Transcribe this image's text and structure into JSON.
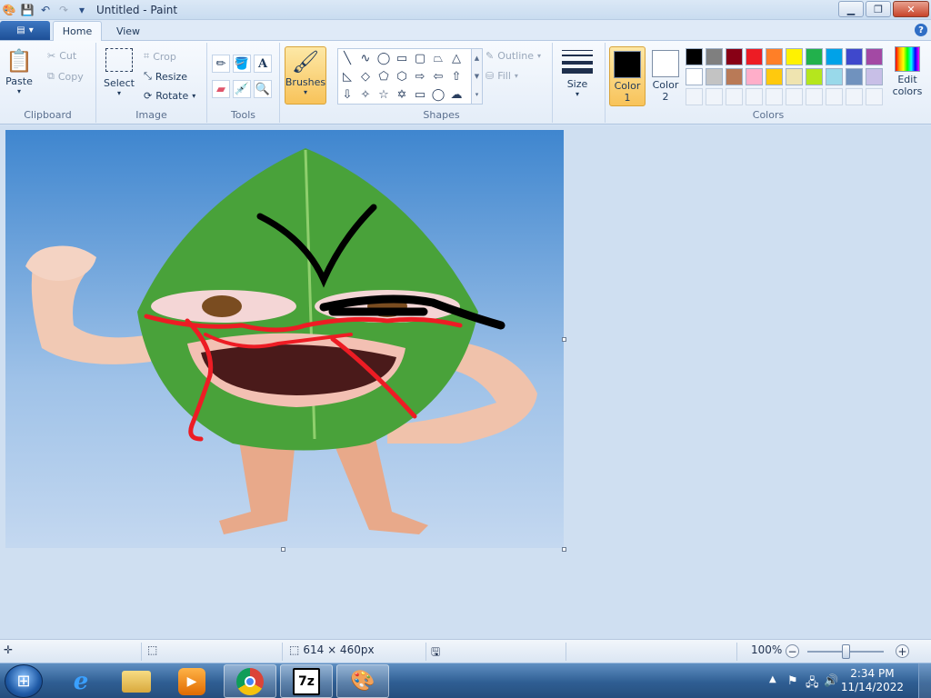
{
  "window": {
    "title": "Untitled - Paint"
  },
  "tabs": {
    "home": "Home",
    "view": "View"
  },
  "ribbon": {
    "clipboard": {
      "label": "Clipboard",
      "paste": "Paste",
      "cut": "Cut",
      "copy": "Copy"
    },
    "image": {
      "label": "Image",
      "select": "Select",
      "crop": "Crop",
      "resize": "Resize",
      "rotate": "Rotate"
    },
    "tools": {
      "label": "Tools",
      "text_glyph": "A"
    },
    "brushes": {
      "label": "Brushes"
    },
    "shapes": {
      "label": "Shapes",
      "outline": "Outline",
      "fill": "Fill"
    },
    "size": {
      "label": "Size"
    },
    "colors": {
      "label": "Colors",
      "color1_line1": "Color",
      "color1_line2": "1",
      "color2_line1": "Color",
      "color2_line2": "2",
      "color1_value": "#000000",
      "color2_value": "#ffffff",
      "edit_line1": "Edit",
      "edit_line2": "colors",
      "palette_row1": [
        "#000000",
        "#7f7f7f",
        "#880015",
        "#ed1c24",
        "#ff7f27",
        "#fff200",
        "#22b14c",
        "#00a2e8",
        "#3f48cc",
        "#a349a4"
      ],
      "palette_row2": [
        "#ffffff",
        "#c3c3c3",
        "#b97a57",
        "#ffaec9",
        "#ffc90e",
        "#efe4b0",
        "#b5e61d",
        "#99d9ea",
        "#7092be",
        "#c8bfe7"
      ]
    }
  },
  "statusbar": {
    "dimensions": "614 × 460px",
    "zoom": "100%"
  },
  "taskbar": {
    "time": "2:34 PM",
    "date": "11/14/2022",
    "app_7z": "7z"
  }
}
